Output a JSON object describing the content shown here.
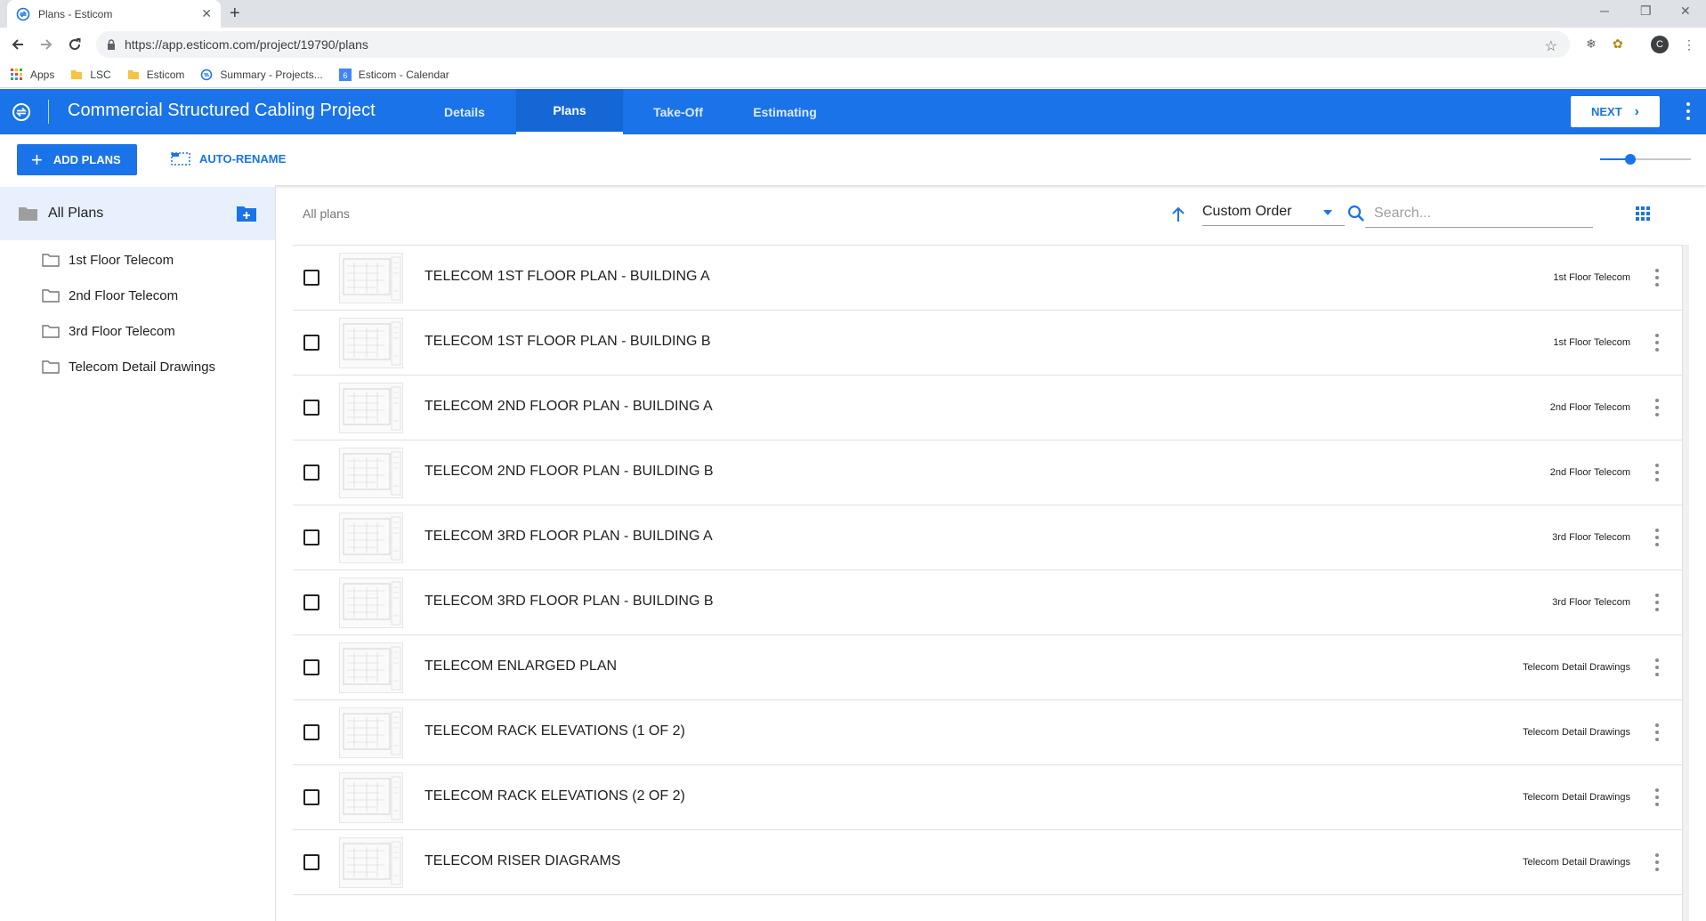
{
  "browser": {
    "tab_title": "Plans - Esticom",
    "url": "https://app.esticom.com/project/19790/plans",
    "profile_initial": "C",
    "bookmarks": [
      {
        "label": "Apps",
        "icon": "apps-grid-icon"
      },
      {
        "label": "LSC",
        "icon": "folder-icon"
      },
      {
        "label": "Esticom",
        "icon": "folder-icon"
      },
      {
        "label": "Summary - Projects...",
        "icon": "esticom-favicon"
      },
      {
        "label": "Esticom - Calendar",
        "icon": "calendar-icon"
      }
    ]
  },
  "app": {
    "project_title": "Commercial Structured Cabling Project",
    "tabs": [
      {
        "label": "Details",
        "active": false
      },
      {
        "label": "Plans",
        "active": true
      },
      {
        "label": "Take-Off",
        "active": false
      },
      {
        "label": "Estimating",
        "active": false
      }
    ],
    "next_label": "NEXT",
    "accent_color": "#1a73e8"
  },
  "actions": {
    "add_plans": "ADD PLANS",
    "auto_rename": "AUTO-RENAME",
    "zoom_slider_fraction": 0.33
  },
  "sidebar": {
    "all_plans": "All Plans",
    "folders": [
      "1st Floor Telecom",
      "2nd Floor Telecom",
      "3rd Floor Telecom",
      "Telecom Detail Drawings"
    ]
  },
  "main": {
    "breadcrumb": "All plans",
    "sort_label": "Custom Order",
    "sort_direction": "ascending",
    "search_placeholder": "Search...",
    "plans": [
      {
        "name": "TELECOM 1ST FLOOR PLAN - BUILDING A",
        "folder": "1st Floor Telecom"
      },
      {
        "name": "TELECOM 1ST FLOOR PLAN - BUILDING B",
        "folder": "1st Floor Telecom"
      },
      {
        "name": "TELECOM 2ND FLOOR PLAN - BUILDING A",
        "folder": "2nd Floor Telecom"
      },
      {
        "name": "TELECOM 2ND FLOOR PLAN - BUILDING B",
        "folder": "2nd Floor Telecom"
      },
      {
        "name": "TELECOM 3RD FLOOR PLAN - BUILDING A",
        "folder": "3rd Floor Telecom"
      },
      {
        "name": "TELECOM 3RD FLOOR PLAN - BUILDING B",
        "folder": "3rd Floor Telecom"
      },
      {
        "name": "TELECOM ENLARGED PLAN",
        "folder": "Telecom Detail Drawings"
      },
      {
        "name": "TELECOM RACK ELEVATIONS (1 OF 2)",
        "folder": "Telecom Detail Drawings"
      },
      {
        "name": "TELECOM RACK ELEVATIONS (2 OF 2)",
        "folder": "Telecom Detail Drawings"
      },
      {
        "name": "TELECOM RISER DIAGRAMS",
        "folder": "Telecom Detail Drawings"
      }
    ]
  }
}
